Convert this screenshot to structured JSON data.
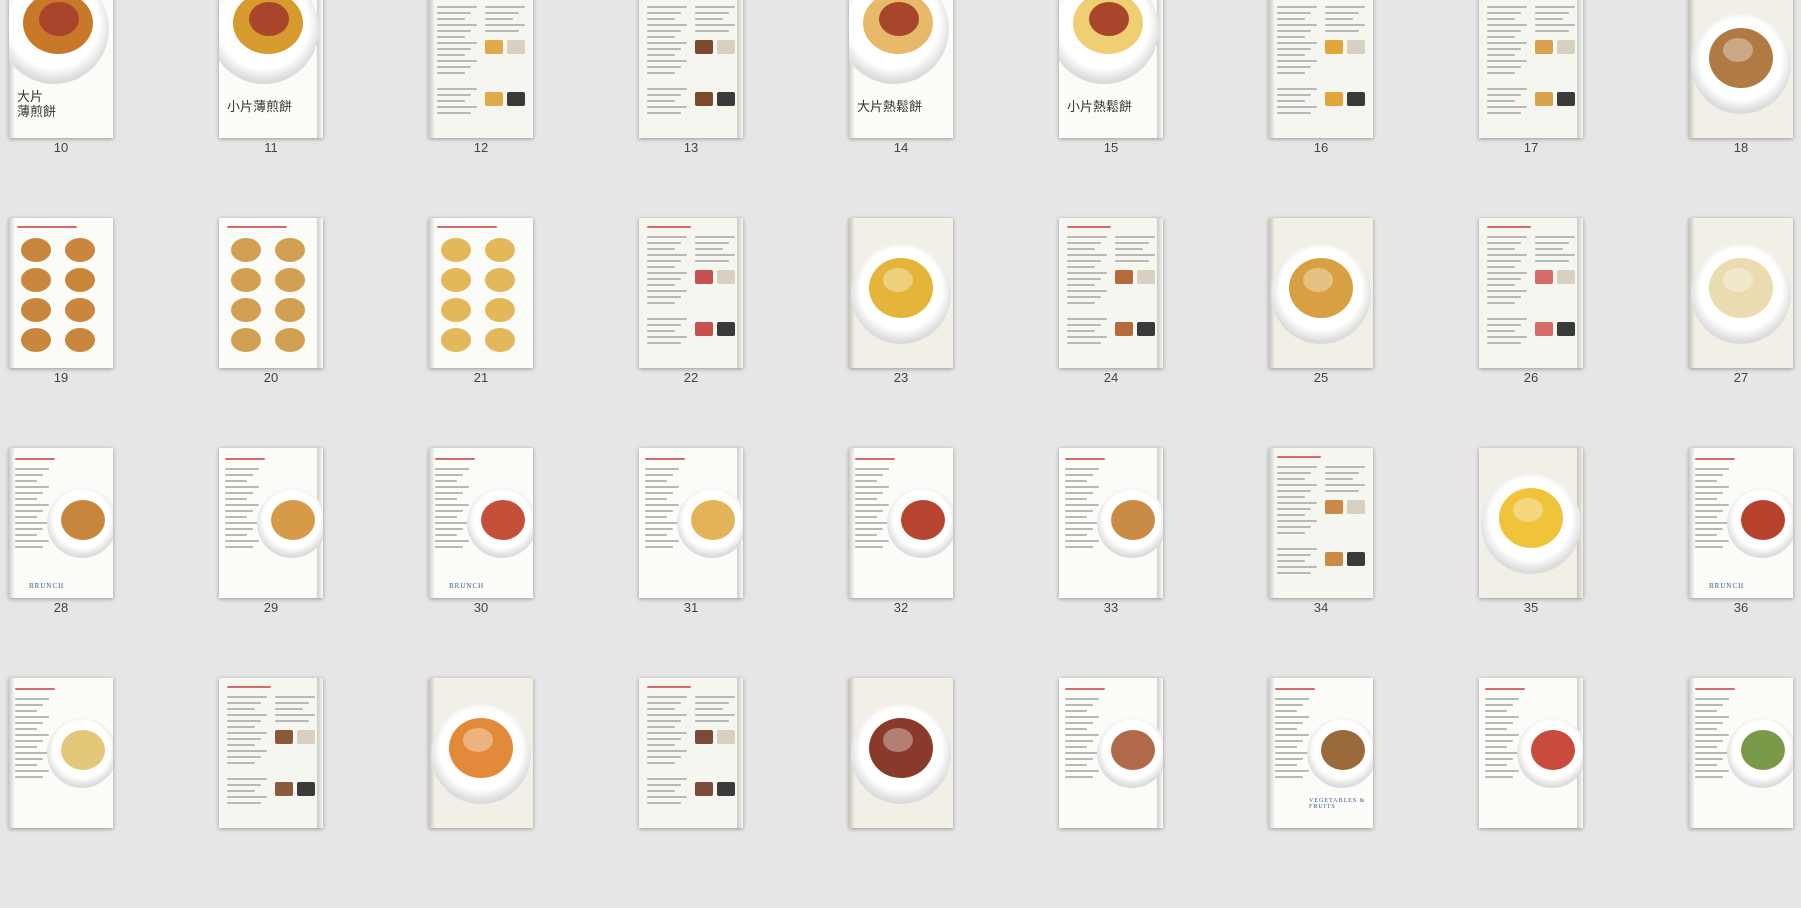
{
  "pages": [
    {
      "num": "10",
      "kind": "cover",
      "title": "大片\n薄煎餅",
      "food": "#c9782a"
    },
    {
      "num": "11",
      "kind": "cover",
      "title": "小片薄煎餅",
      "food": "#d69a2e"
    },
    {
      "num": "12",
      "kind": "text",
      "food": "#e0a94a"
    },
    {
      "num": "13",
      "kind": "text",
      "food": "#7a4a2a"
    },
    {
      "num": "14",
      "kind": "cover",
      "title": "大片熱鬆餅",
      "food": "#e7b96a"
    },
    {
      "num": "15",
      "kind": "cover",
      "title": "小片熱鬆餅",
      "food": "#f0cf74"
    },
    {
      "num": "16",
      "kind": "text",
      "food": "#e2a53a"
    },
    {
      "num": "17",
      "kind": "text",
      "food": "#d8a14c"
    },
    {
      "num": "18",
      "kind": "photo",
      "food": "#b07a44"
    },
    {
      "num": "19",
      "kind": "grid",
      "food": "#c8873c"
    },
    {
      "num": "20",
      "kind": "grid",
      "food": "#d1a053"
    },
    {
      "num": "21",
      "kind": "grid",
      "food": "#e3b85a"
    },
    {
      "num": "22",
      "kind": "text",
      "food": "#c85050"
    },
    {
      "num": "23",
      "kind": "photo",
      "food": "#e5b53a"
    },
    {
      "num": "24",
      "kind": "text",
      "food": "#b46a3a"
    },
    {
      "num": "25",
      "kind": "photo",
      "food": "#d8a043"
    },
    {
      "num": "26",
      "kind": "text",
      "food": "#d86a6a"
    },
    {
      "num": "27",
      "kind": "photo",
      "food": "#eadcb0"
    },
    {
      "num": "28",
      "kind": "mixed",
      "food": "#c7863c"
    },
    {
      "num": "29",
      "kind": "mixed",
      "food": "#d79a48"
    },
    {
      "num": "30",
      "kind": "mixed",
      "food": "#c4503a"
    },
    {
      "num": "31",
      "kind": "mixed",
      "food": "#e3b35a"
    },
    {
      "num": "32",
      "kind": "mixed",
      "food": "#b6452f"
    },
    {
      "num": "33",
      "kind": "mixed",
      "food": "#c98b45"
    },
    {
      "num": "34",
      "kind": "text",
      "food": "#c98b45"
    },
    {
      "num": "35",
      "kind": "photo",
      "food": "#f0c43a"
    },
    {
      "num": "36",
      "kind": "mixed",
      "food": "#b8432c"
    },
    {
      "num": "",
      "kind": "mixed",
      "food": "#e5c77a"
    },
    {
      "num": "",
      "kind": "text",
      "food": "#8a5a3a"
    },
    {
      "num": "",
      "kind": "photo",
      "food": "#e38a3a"
    },
    {
      "num": "",
      "kind": "text",
      "food": "#7a4a3a"
    },
    {
      "num": "",
      "kind": "photo",
      "food": "#8a3a2a"
    },
    {
      "num": "",
      "kind": "mixed",
      "food": "#b06a4a"
    },
    {
      "num": "",
      "kind": "mixed",
      "food": "#9a6a3a"
    },
    {
      "num": "",
      "kind": "mixed",
      "food": "#c84a3a"
    },
    {
      "num": "",
      "kind": "mixed",
      "food": "#7a9a4a"
    }
  ],
  "brunch_label": "BRUNCH",
  "fruits_label": "VEGETABLES & FRUITS",
  "colors": {
    "background": "#e6e6e6",
    "accent": "#3a5a9a"
  }
}
